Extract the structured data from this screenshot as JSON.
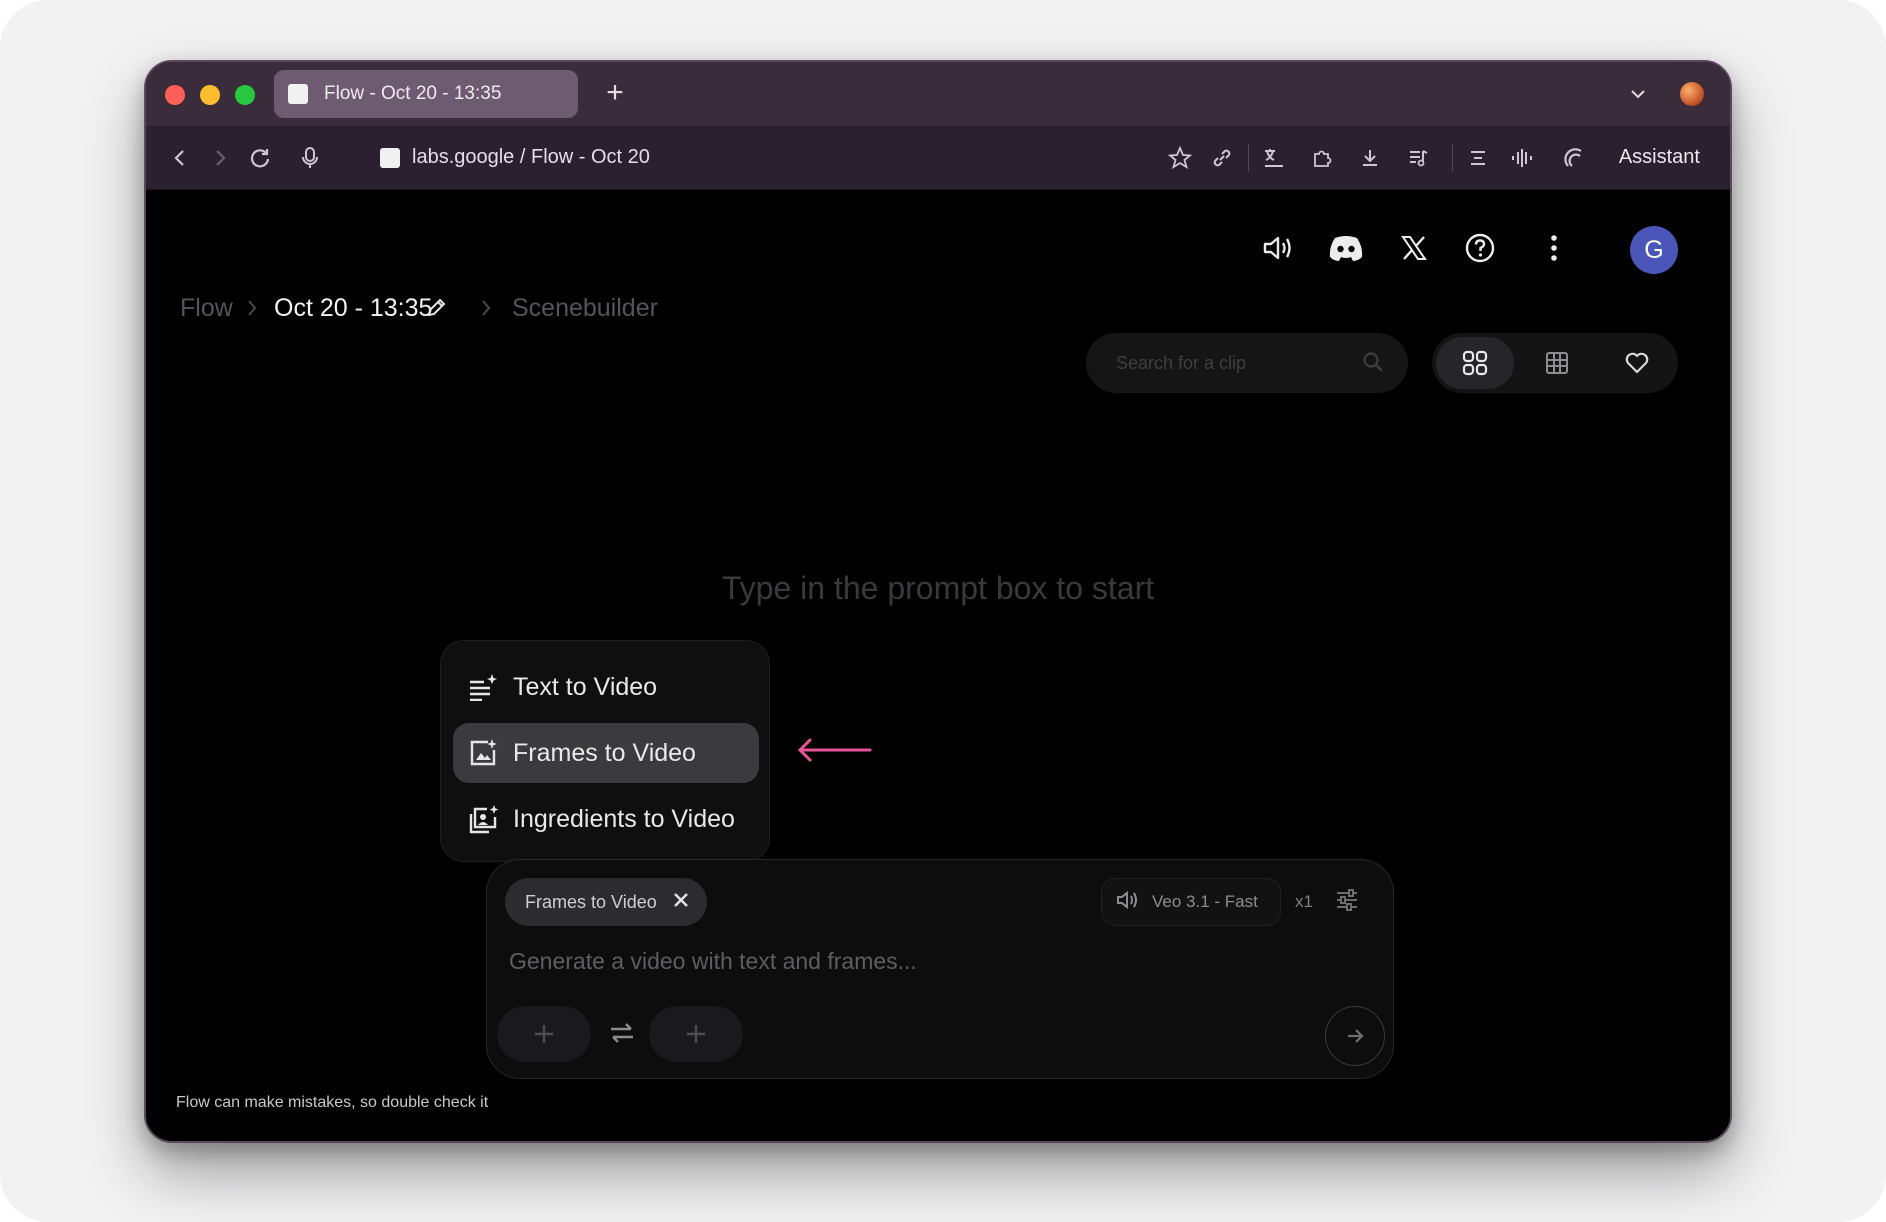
{
  "browser": {
    "tab_title": "Flow - Oct 20 - 13:35",
    "new_tab_label": "+",
    "url": "labs.google / Flow - Oct 20",
    "assistant_label": "Assistant"
  },
  "header": {
    "breadcrumb_root": "Flow",
    "breadcrumb_project": "Oct 20 - 13:35",
    "breadcrumb_view": "Scenebuilder",
    "avatar_initial": "G"
  },
  "search": {
    "placeholder": "Search for a clip"
  },
  "main": {
    "empty_message": "Type in the prompt box to start"
  },
  "mode_menu": {
    "items": [
      {
        "label": "Text to Video",
        "icon": "text-sparkle-icon",
        "selected": false
      },
      {
        "label": "Frames to Video",
        "icon": "image-frames-icon",
        "selected": true
      },
      {
        "label": "Ingredients to Video",
        "icon": "ingredients-icon",
        "selected": false
      }
    ]
  },
  "prompt": {
    "mode_chip": "Frames to Video",
    "model": "Veo 3.1 - Fast",
    "output_count": "x1",
    "placeholder": "Generate a video with text and frames..."
  },
  "footer": {
    "disclaimer": "Flow can make mistakes, so double check it"
  },
  "colors": {
    "background": "#000000",
    "accent_avatar": "#4a56b8",
    "annotation_arrow": "#e8539a",
    "menu_selected": "#3b3b3e"
  }
}
